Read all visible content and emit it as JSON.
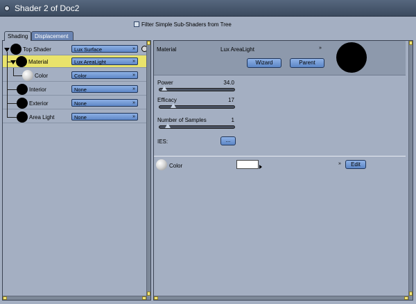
{
  "window": {
    "title": "Shader 2 of Doc2"
  },
  "filter": {
    "label": "Filter Simple Sub-Shaders from Tree",
    "checked": false
  },
  "tabs": [
    {
      "label": "Shading",
      "active": true
    },
    {
      "label": "Displacement",
      "active": false
    }
  ],
  "tree": {
    "nodes": [
      {
        "label": "Top Shader",
        "value": "Lux Surface"
      },
      {
        "label": "Material",
        "value": "Lux AreaLight",
        "selected": true
      },
      {
        "label": "Color",
        "value": "Color"
      },
      {
        "label": "Interior",
        "value": "None"
      },
      {
        "label": "Exterior",
        "value": "None"
      },
      {
        "label": "Area Light",
        "value": "None"
      }
    ]
  },
  "material": {
    "label": "Material",
    "value": "Lux AreaLight",
    "wizard_label": "Wizard",
    "parent_label": "Parent"
  },
  "params": {
    "power": {
      "label": "Power",
      "value": "34.0",
      "fraction": 0.03
    },
    "efficacy": {
      "label": "Efficacy",
      "value": "17",
      "fraction": 0.15
    },
    "samples": {
      "label": "Number of Samples",
      "value": "1",
      "fraction": 0.07
    },
    "ies": {
      "label": "IES:",
      "button": "..."
    }
  },
  "color_row": {
    "label": "Color",
    "swatch": "#ffffff",
    "edit_label": "Edit"
  },
  "colors": {
    "titlebar": "#3b4a5e",
    "panel": "#a4afc2",
    "selected_row": "#e9e36b",
    "button": "#6f97d6"
  }
}
